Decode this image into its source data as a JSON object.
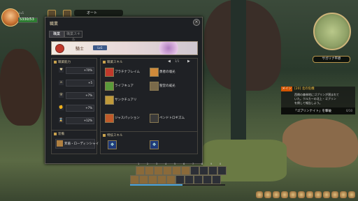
{
  "hud": {
    "level_label": "Lv1",
    "hp_text": "5330/53",
    "hp_fraction": 1.0,
    "top_label": "オート"
  },
  "window": {
    "title": "職業",
    "close_glyph": "×",
    "tabs": [
      "職業",
      "職業スキル"
    ],
    "banner": {
      "name": "騎士",
      "badge": "Lv1"
    }
  },
  "stats_panel": {
    "title": "職業能力",
    "rows": [
      {
        "icon": "heart-icon",
        "glyph": "♥",
        "value": "+70%"
      },
      {
        "icon": "sword-icon",
        "glyph": "⚔",
        "value": "+5"
      },
      {
        "icon": "shield-icon",
        "glyph": "⛨",
        "value": "+7%"
      },
      {
        "icon": "fist-icon",
        "glyph": "✊",
        "value": "+7%"
      },
      {
        "icon": "hourglass-icon",
        "glyph": "⌛",
        "value": "+12%"
      },
      {
        "icon": "flame-icon",
        "glyph": "♨",
        "value": "+7%"
      }
    ]
  },
  "skills_panel": {
    "title": "職業スキル",
    "pager": "1/1",
    "prev": "◀",
    "next": "▶",
    "skills": [
      {
        "name": "プラチナフレイム",
        "color": "#c0392b"
      },
      {
        "name": "勇者の魂光",
        "color": "#d08a3a"
      },
      {
        "name": "ライフキュア",
        "color": "#5a9a3a"
      },
      {
        "name": "聖堂の威光",
        "color": "#7a6a4a"
      },
      {
        "name": "サンクチュアリ",
        "color": "#c09a3a"
      },
      {
        "name": "ジャスパッション",
        "color": "#c05a2a"
      },
      {
        "name": "ペンドトロギズム",
        "color": "#3a3a3a"
      }
    ]
  },
  "weapon_panel": {
    "title": "装備",
    "item": "斧盾・ローディンシャイ"
  },
  "special_panel": {
    "title": "特技スキル",
    "slots": [
      "✥",
      "✥"
    ]
  },
  "minimap": {
    "location": "サガリナ平原"
  },
  "quest": {
    "tag": "メイン",
    "title": "[20] 北の危機",
    "lines": [
      "西側の森林地にゴブリンが潜まれて",
      "いた。クルカーの北上・ゴブリン",
      "を倒して報告しよう。"
    ],
    "tracker": "「ゴブリンナイト」を撃破",
    "count": "0/10"
  },
  "hotbar": {
    "top_numbers": [
      "1",
      "2",
      "3",
      "4",
      "5",
      "6",
      "7",
      "8",
      "9",
      "0"
    ],
    "exp_fraction": 0.55
  },
  "colors": {
    "accent": "#c9a24d",
    "panel": "#1f2125",
    "quest_tag": "#d35400"
  }
}
